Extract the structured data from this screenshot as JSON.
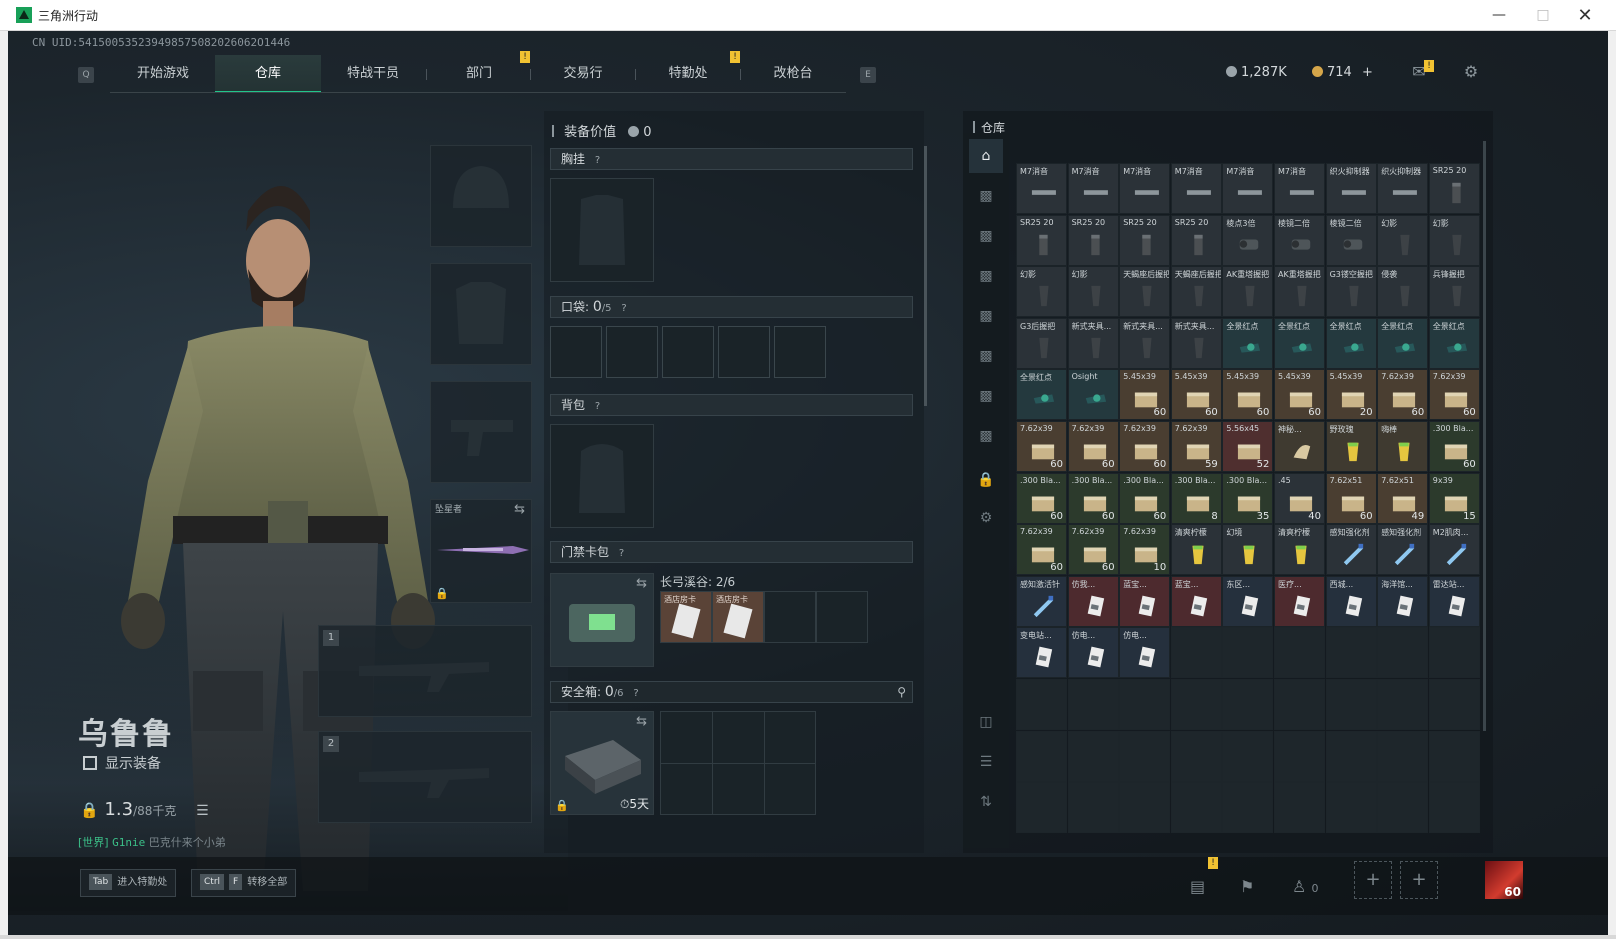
{
  "window": {
    "title": "三角洲行动"
  },
  "uid": "CN UID:541500535239498575082026062O1446",
  "nav": {
    "left_key": "Q",
    "right_key": "E",
    "tabs": [
      "开始游戏",
      "仓库",
      "特战干员",
      "部门",
      "交易行",
      "特勤处",
      "改枪台"
    ],
    "active": "仓库",
    "badge": "!"
  },
  "currency": {
    "silver": "1,287K",
    "gold": "714",
    "plus": "+"
  },
  "character": {
    "name": "乌鲁鲁",
    "show_equipment": "显示装备",
    "weight": "1.3",
    "weight_max": "/88千克",
    "chat_channel": "[世界]",
    "chat_user": "G1nie",
    "chat_text": "巴克什来个小弟"
  },
  "equip_slots": {
    "melee_label": "坠星者",
    "gun1": "1",
    "gun2": "2"
  },
  "loadout": {
    "value_label": "装备价值",
    "value": "0",
    "chest_rig": "胸挂",
    "pockets": "口袋:",
    "pockets_count": "0",
    "pockets_max": "/5",
    "backpack": "背包",
    "keycard": "门禁卡包",
    "keycard_zone": "长弓溪谷: 2/6",
    "keycard_item": "酒店房卡",
    "safebox": "安全箱:",
    "safebox_count": "0",
    "safebox_max": "/6",
    "safebox_timer": "5天",
    "help": "?"
  },
  "warehouse": {
    "title": "仓库",
    "items": [
      {
        "name": "M7消音",
        "count": "",
        "color": "#2b3238",
        "icon": "suppressor"
      },
      {
        "name": "M7消音",
        "count": "",
        "color": "#2b3238",
        "icon": "suppressor"
      },
      {
        "name": "M7消音",
        "count": "",
        "color": "#2b3238",
        "icon": "suppressor"
      },
      {
        "name": "M7消音",
        "count": "",
        "color": "#2b3238",
        "icon": "suppressor"
      },
      {
        "name": "M7消音",
        "count": "",
        "color": "#2b3238",
        "icon": "suppressor"
      },
      {
        "name": "M7消音",
        "count": "",
        "color": "#2b3238",
        "icon": "suppressor"
      },
      {
        "name": "织火抑制器",
        "count": "",
        "color": "#2b3238",
        "icon": "suppressor"
      },
      {
        "name": "织火抑制器",
        "count": "",
        "color": "#2b3238",
        "icon": "suppressor"
      },
      {
        "name": "SR25 20",
        "count": "",
        "color": "#2b3238",
        "icon": "magazine"
      },
      {
        "name": "SR25 20",
        "count": "",
        "color": "#2b3238",
        "icon": "magazine"
      },
      {
        "name": "SR25 20",
        "count": "",
        "color": "#2b3238",
        "icon": "magazine"
      },
      {
        "name": "SR25 20",
        "count": "",
        "color": "#2b3238",
        "icon": "magazine"
      },
      {
        "name": "SR25 20",
        "count": "",
        "color": "#2b3238",
        "icon": "magazine"
      },
      {
        "name": "棱点3倍",
        "count": "",
        "color": "#2b3238",
        "icon": "scope"
      },
      {
        "name": "棱镜二倍",
        "count": "",
        "color": "#2b3238",
        "icon": "scope"
      },
      {
        "name": "棱镜二倍",
        "count": "",
        "color": "#2b3238",
        "icon": "scope"
      },
      {
        "name": "幻影",
        "count": "",
        "color": "#2b3238",
        "icon": "grip"
      },
      {
        "name": "幻影",
        "count": "",
        "color": "#2b3238",
        "icon": "grip"
      },
      {
        "name": "幻影",
        "count": "",
        "color": "#2b3238",
        "icon": "grip"
      },
      {
        "name": "幻影",
        "count": "",
        "color": "#2b3238",
        "icon": "grip"
      },
      {
        "name": "天蝎座后握把",
        "count": "",
        "color": "#2b3238",
        "icon": "grip"
      },
      {
        "name": "天蝎座后握把",
        "count": "",
        "color": "#2b3238",
        "icon": "grip"
      },
      {
        "name": "AK重塔握把",
        "count": "",
        "color": "#2b3238",
        "icon": "grip"
      },
      {
        "name": "AK重塔握把",
        "count": "",
        "color": "#2b3238",
        "icon": "grip"
      },
      {
        "name": "G3镂空握把",
        "count": "",
        "color": "#2b3238",
        "icon": "grip"
      },
      {
        "name": "侵袭",
        "count": "",
        "color": "#2b3238",
        "icon": "grip"
      },
      {
        "name": "兵锋握把",
        "count": "",
        "color": "#2b3238",
        "icon": "grip"
      },
      {
        "name": "G3后握把",
        "count": "",
        "color": "#2b3238",
        "icon": "grip"
      },
      {
        "name": "新式夹具...",
        "count": "",
        "color": "#2b3238",
        "icon": "grip"
      },
      {
        "name": "新式夹具...",
        "count": "",
        "color": "#2b3238",
        "icon": "grip"
      },
      {
        "name": "新式夹具...",
        "count": "",
        "color": "#2b3238",
        "icon": "grip"
      },
      {
        "name": "全景红点",
        "count": "",
        "color": "#24393e",
        "icon": "reddot"
      },
      {
        "name": "全景红点",
        "count": "",
        "color": "#24393e",
        "icon": "reddot"
      },
      {
        "name": "全景红点",
        "count": "",
        "color": "#24393e",
        "icon": "reddot"
      },
      {
        "name": "全景红点",
        "count": "",
        "color": "#24393e",
        "icon": "reddot"
      },
      {
        "name": "全景红点",
        "count": "",
        "color": "#24393e",
        "icon": "reddot"
      },
      {
        "name": "全景红点",
        "count": "",
        "color": "#24393e",
        "icon": "reddot"
      },
      {
        "name": "Osight",
        "count": "",
        "color": "#24393e",
        "icon": "reddot"
      },
      {
        "name": "5.45x39",
        "count": "60",
        "color": "#4a3e31",
        "icon": "ammo"
      },
      {
        "name": "5.45x39",
        "count": "60",
        "color": "#4a3e31",
        "icon": "ammo"
      },
      {
        "name": "5.45x39",
        "count": "60",
        "color": "#4a3e31",
        "icon": "ammo"
      },
      {
        "name": "5.45x39",
        "count": "60",
        "color": "#4a3e31",
        "icon": "ammo"
      },
      {
        "name": "5.45x39",
        "count": "20",
        "color": "#4a3e31",
        "icon": "ammo"
      },
      {
        "name": "7.62x39",
        "count": "60",
        "color": "#4a3e31",
        "icon": "ammo"
      },
      {
        "name": "7.62x39",
        "count": "60",
        "color": "#4a3e31",
        "icon": "ammo"
      },
      {
        "name": "7.62x39",
        "count": "60",
        "color": "#4a3e31",
        "icon": "ammo"
      },
      {
        "name": "7.62x39",
        "count": "60",
        "color": "#4a3e31",
        "icon": "ammo"
      },
      {
        "name": "7.62x39",
        "count": "60",
        "color": "#4a3e31",
        "icon": "ammo"
      },
      {
        "name": "7.62x39",
        "count": "59",
        "color": "#4a3e31",
        "icon": "ammo"
      },
      {
        "name": "5.56x45",
        "count": "52",
        "color": "#4f2f2f",
        "icon": "ammo"
      },
      {
        "name": "神秘...",
        "count": "",
        "color": "#3f3a30",
        "icon": "misc"
      },
      {
        "name": "野玫瑰",
        "count": "",
        "color": "#3f3a30",
        "icon": "drink"
      },
      {
        "name": "嗨棒",
        "count": "",
        "color": "#3f3a30",
        "icon": "drink"
      },
      {
        "name": ".300 Bla...",
        "count": "60",
        "color": "#2c3a2c",
        "icon": "ammo"
      },
      {
        "name": ".300 Bla...",
        "count": "60",
        "color": "#2c3a2c",
        "icon": "ammo"
      },
      {
        "name": ".300 Bla...",
        "count": "60",
        "color": "#2c3a2c",
        "icon": "ammo"
      },
      {
        "name": ".300 Bla...",
        "count": "60",
        "color": "#2c3a2c",
        "icon": "ammo"
      },
      {
        "name": ".300 Bla...",
        "count": "8",
        "color": "#2c3a2c",
        "icon": "ammo"
      },
      {
        "name": ".300 Bla...",
        "count": "35",
        "color": "#2c3a2c",
        "icon": "ammo"
      },
      {
        "name": ".45",
        "count": "40",
        "color": "#2b3238",
        "icon": "ammo"
      },
      {
        "name": "7.62x51",
        "count": "60",
        "color": "#4a3e31",
        "icon": "ammo"
      },
      {
        "name": "7.62x51",
        "count": "49",
        "color": "#4a3e31",
        "icon": "ammo"
      },
      {
        "name": "9x39",
        "count": "15",
        "color": "#2c3a2c",
        "icon": "ammo"
      },
      {
        "name": "7.62x39",
        "count": "60",
        "color": "#2c3a2c",
        "icon": "ammo"
      },
      {
        "name": "7.62x39",
        "count": "60",
        "color": "#2c3a2c",
        "icon": "ammo"
      },
      {
        "name": "7.62x39",
        "count": "10",
        "color": "#2c3a2c",
        "icon": "ammo"
      },
      {
        "name": "清爽柠檬",
        "count": "",
        "color": "#2b3238",
        "icon": "drink"
      },
      {
        "name": "幻境",
        "count": "",
        "color": "#2b3238",
        "icon": "drink"
      },
      {
        "name": "清爽柠檬",
        "count": "",
        "color": "#2b3238",
        "icon": "drink"
      },
      {
        "name": "感知强化剂",
        "count": "",
        "color": "#2b3238",
        "icon": "syringe"
      },
      {
        "name": "感知强化剂",
        "count": "",
        "color": "#2b3238",
        "icon": "syringe"
      },
      {
        "name": "M2肌肉...",
        "count": "",
        "color": "#2b3238",
        "icon": "syringe"
      },
      {
        "name": "感知激活针",
        "count": "",
        "color": "#25303d",
        "icon": "syringe"
      },
      {
        "name": "仿我...",
        "count": "",
        "color": "#4d2a2e",
        "icon": "card"
      },
      {
        "name": "蓝宝...",
        "count": "",
        "color": "#4d2a2e",
        "icon": "card"
      },
      {
        "name": "蓝宝...",
        "count": "",
        "color": "#4d2a2e",
        "icon": "card"
      },
      {
        "name": "东区...",
        "count": "",
        "color": "#25303d",
        "icon": "card"
      },
      {
        "name": "医疗...",
        "count": "",
        "color": "#4d2a2e",
        "icon": "card"
      },
      {
        "name": "西城...",
        "count": "",
        "color": "#25303d",
        "icon": "card"
      },
      {
        "name": "海洋馆...",
        "count": "",
        "color": "#25303d",
        "icon": "card"
      },
      {
        "name": "雷达站...",
        "count": "",
        "color": "#25303d",
        "icon": "card"
      },
      {
        "name": "变电站...",
        "count": "",
        "color": "#25303d",
        "icon": "card"
      },
      {
        "name": "仿电...",
        "count": "",
        "color": "#25303d",
        "icon": "card"
      },
      {
        "name": "仿电...",
        "count": "",
        "color": "#25303d",
        "icon": "card"
      }
    ]
  },
  "bottom": {
    "tab_key": "Tab",
    "tab_label": "进入特勤处",
    "ctrl_key": "Ctrl",
    "f_key": "F",
    "ctrl_label": "转移全部",
    "friends": "0",
    "avatar_level": "60"
  },
  "colors": {
    "accent": "#22c58b",
    "badge": "#f1c232"
  }
}
